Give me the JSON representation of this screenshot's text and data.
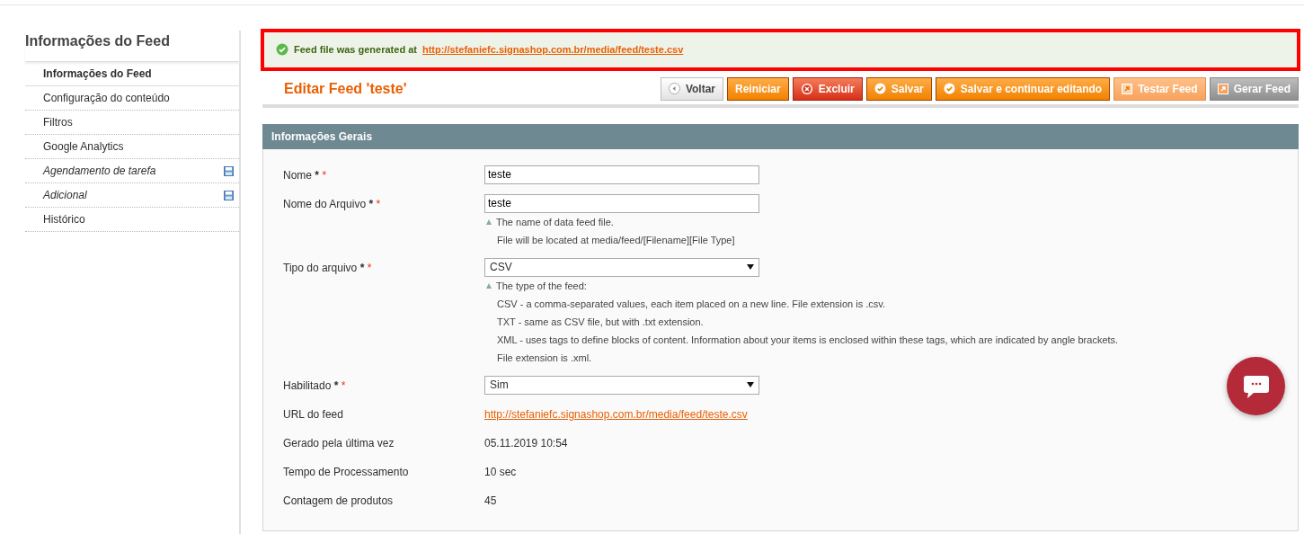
{
  "sidebar": {
    "title": "Informações do Feed",
    "items": [
      {
        "label": "Informações do Feed",
        "selected": true,
        "kind": "plain"
      },
      {
        "label": "Configuração do conteúdo",
        "selected": false,
        "kind": "plain"
      },
      {
        "label": "Filtros",
        "selected": false,
        "kind": "plain"
      },
      {
        "label": "Google Analytics",
        "selected": false,
        "kind": "plain"
      },
      {
        "label": "Agendamento de tarefa",
        "selected": false,
        "kind": "changed"
      },
      {
        "label": "Adicional",
        "selected": false,
        "kind": "changed"
      },
      {
        "label": "Histórico",
        "selected": false,
        "kind": "plain"
      }
    ]
  },
  "message": {
    "text": "Feed file was generated at",
    "link": "http://stefaniefc.signashop.com.br/media/feed/teste.csv",
    "highlighted": true
  },
  "page_title": "Editar Feed 'teste'",
  "buttons": [
    {
      "label": "Voltar",
      "kind": "back"
    },
    {
      "label": "Reiniciar",
      "kind": "reset"
    },
    {
      "label": "Excluir",
      "kind": "delete"
    },
    {
      "label": "Salvar",
      "kind": "save"
    },
    {
      "label": "Salvar e continuar editando",
      "kind": "save"
    },
    {
      "label": "Testar Feed",
      "kind": "test"
    },
    {
      "label": "Gerar Feed",
      "kind": "generate"
    }
  ],
  "section": {
    "title": "Informações Gerais",
    "fields": [
      {
        "label": "Nome",
        "required_marks": [
          "*",
          "*"
        ],
        "kind": "input",
        "value": "teste"
      },
      {
        "label": "Nome do Arquivo",
        "required_marks": [
          "*",
          "*"
        ],
        "kind": "input",
        "value": "teste",
        "notes": [
          "The name of data feed file.",
          "File will be located at media/feed/[Filename][File Type]"
        ]
      },
      {
        "label": "Tipo do arquivo",
        "required_marks": [
          "*",
          "*"
        ],
        "kind": "select",
        "value": "CSV",
        "notes": [
          "The type of the feed:",
          "CSV - a comma-separated values, each item placed on a new line. File extension is .csv.",
          "TXT - same as CSV file, but with .txt extension.",
          "XML - uses tags to define blocks of content. Information about your items is enclosed within these tags, which are indicated by angle brackets.",
          "File extension is .xml."
        ]
      },
      {
        "label": "Habilitado",
        "required_marks": [
          "*",
          "*"
        ],
        "kind": "select",
        "value": "Sim"
      },
      {
        "label": "URL do feed",
        "kind": "link",
        "value": "http://stefaniefc.signashop.com.br/media/feed/teste.csv"
      },
      {
        "label": "Gerado pela última vez",
        "kind": "text",
        "value": "05.11.2019 10:54"
      },
      {
        "label": "Tempo de Processamento",
        "kind": "text",
        "value": "10 sec"
      },
      {
        "label": "Contagem de produtos",
        "kind": "text",
        "value": "45"
      }
    ]
  }
}
